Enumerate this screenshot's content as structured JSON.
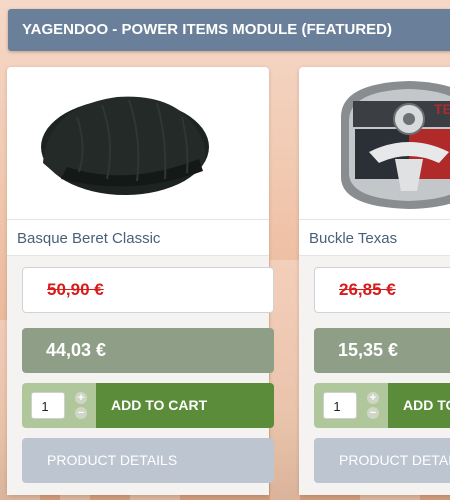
{
  "module": {
    "title": "YAGENDOO - POWER ITEMS MODULE (FEATURED)"
  },
  "products": [
    {
      "name": "Basque Beret Classic",
      "image": "black-knit-beret-photo",
      "old_price": "50,90 €",
      "new_price": "44,03 €",
      "quantity": "1",
      "add_to_cart_label": "ADD TO CART",
      "details_label": "PRODUCT DETAILS"
    },
    {
      "name": "Buckle Texas",
      "image": "texas-belt-buckle-photo",
      "old_price": "26,85 €",
      "new_price": "15,35 €",
      "quantity": "1",
      "add_to_cart_label": "ADD TO CART",
      "details_label": "PRODUCT DETAILS"
    }
  ],
  "icons": {
    "qty_up": "plus-icon",
    "qty_down": "minus-icon"
  },
  "colors": {
    "header_bg": "#6a7f99",
    "old_price_text": "#d81b1b",
    "new_price_bg": "#8f9e87",
    "add_to_cart_bg": "#5a8c39",
    "cart_row_bg": "#b0c79b",
    "details_bg": "#bcc5d0"
  }
}
